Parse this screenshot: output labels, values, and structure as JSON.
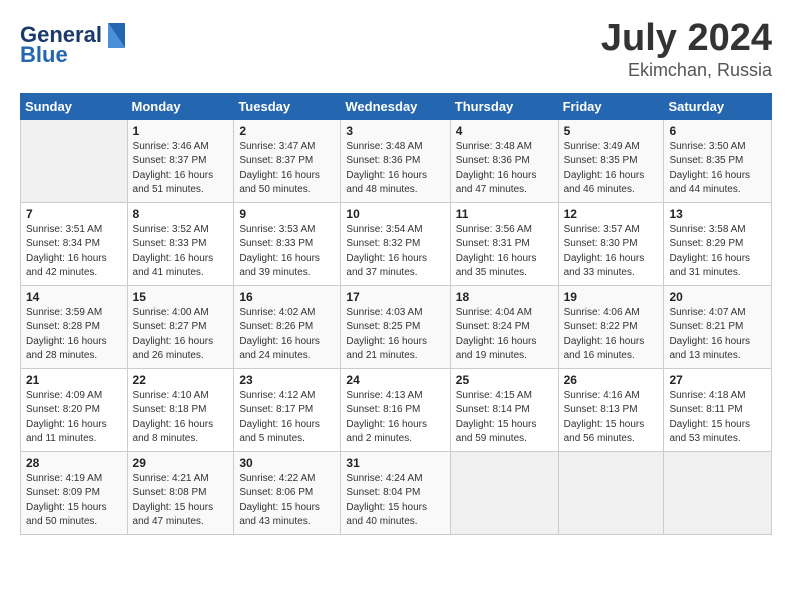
{
  "header": {
    "logo_line1": "General",
    "logo_line2": "Blue",
    "main_title": "July 2024",
    "subtitle": "Ekimchan, Russia"
  },
  "calendar": {
    "days_of_week": [
      "Sunday",
      "Monday",
      "Tuesday",
      "Wednesday",
      "Thursday",
      "Friday",
      "Saturday"
    ],
    "weeks": [
      [
        {
          "day": "",
          "info": ""
        },
        {
          "day": "1",
          "info": "Sunrise: 3:46 AM\nSunset: 8:37 PM\nDaylight: 16 hours\nand 51 minutes."
        },
        {
          "day": "2",
          "info": "Sunrise: 3:47 AM\nSunset: 8:37 PM\nDaylight: 16 hours\nand 50 minutes."
        },
        {
          "day": "3",
          "info": "Sunrise: 3:48 AM\nSunset: 8:36 PM\nDaylight: 16 hours\nand 48 minutes."
        },
        {
          "day": "4",
          "info": "Sunrise: 3:48 AM\nSunset: 8:36 PM\nDaylight: 16 hours\nand 47 minutes."
        },
        {
          "day": "5",
          "info": "Sunrise: 3:49 AM\nSunset: 8:35 PM\nDaylight: 16 hours\nand 46 minutes."
        },
        {
          "day": "6",
          "info": "Sunrise: 3:50 AM\nSunset: 8:35 PM\nDaylight: 16 hours\nand 44 minutes."
        }
      ],
      [
        {
          "day": "7",
          "info": "Sunrise: 3:51 AM\nSunset: 8:34 PM\nDaylight: 16 hours\nand 42 minutes."
        },
        {
          "day": "8",
          "info": "Sunrise: 3:52 AM\nSunset: 8:33 PM\nDaylight: 16 hours\nand 41 minutes."
        },
        {
          "day": "9",
          "info": "Sunrise: 3:53 AM\nSunset: 8:33 PM\nDaylight: 16 hours\nand 39 minutes."
        },
        {
          "day": "10",
          "info": "Sunrise: 3:54 AM\nSunset: 8:32 PM\nDaylight: 16 hours\nand 37 minutes."
        },
        {
          "day": "11",
          "info": "Sunrise: 3:56 AM\nSunset: 8:31 PM\nDaylight: 16 hours\nand 35 minutes."
        },
        {
          "day": "12",
          "info": "Sunrise: 3:57 AM\nSunset: 8:30 PM\nDaylight: 16 hours\nand 33 minutes."
        },
        {
          "day": "13",
          "info": "Sunrise: 3:58 AM\nSunset: 8:29 PM\nDaylight: 16 hours\nand 31 minutes."
        }
      ],
      [
        {
          "day": "14",
          "info": "Sunrise: 3:59 AM\nSunset: 8:28 PM\nDaylight: 16 hours\nand 28 minutes."
        },
        {
          "day": "15",
          "info": "Sunrise: 4:00 AM\nSunset: 8:27 PM\nDaylight: 16 hours\nand 26 minutes."
        },
        {
          "day": "16",
          "info": "Sunrise: 4:02 AM\nSunset: 8:26 PM\nDaylight: 16 hours\nand 24 minutes."
        },
        {
          "day": "17",
          "info": "Sunrise: 4:03 AM\nSunset: 8:25 PM\nDaylight: 16 hours\nand 21 minutes."
        },
        {
          "day": "18",
          "info": "Sunrise: 4:04 AM\nSunset: 8:24 PM\nDaylight: 16 hours\nand 19 minutes."
        },
        {
          "day": "19",
          "info": "Sunrise: 4:06 AM\nSunset: 8:22 PM\nDaylight: 16 hours\nand 16 minutes."
        },
        {
          "day": "20",
          "info": "Sunrise: 4:07 AM\nSunset: 8:21 PM\nDaylight: 16 hours\nand 13 minutes."
        }
      ],
      [
        {
          "day": "21",
          "info": "Sunrise: 4:09 AM\nSunset: 8:20 PM\nDaylight: 16 hours\nand 11 minutes."
        },
        {
          "day": "22",
          "info": "Sunrise: 4:10 AM\nSunset: 8:18 PM\nDaylight: 16 hours\nand 8 minutes."
        },
        {
          "day": "23",
          "info": "Sunrise: 4:12 AM\nSunset: 8:17 PM\nDaylight: 16 hours\nand 5 minutes."
        },
        {
          "day": "24",
          "info": "Sunrise: 4:13 AM\nSunset: 8:16 PM\nDaylight: 16 hours\nand 2 minutes."
        },
        {
          "day": "25",
          "info": "Sunrise: 4:15 AM\nSunset: 8:14 PM\nDaylight: 15 hours\nand 59 minutes."
        },
        {
          "day": "26",
          "info": "Sunrise: 4:16 AM\nSunset: 8:13 PM\nDaylight: 15 hours\nand 56 minutes."
        },
        {
          "day": "27",
          "info": "Sunrise: 4:18 AM\nSunset: 8:11 PM\nDaylight: 15 hours\nand 53 minutes."
        }
      ],
      [
        {
          "day": "28",
          "info": "Sunrise: 4:19 AM\nSunset: 8:09 PM\nDaylight: 15 hours\nand 50 minutes."
        },
        {
          "day": "29",
          "info": "Sunrise: 4:21 AM\nSunset: 8:08 PM\nDaylight: 15 hours\nand 47 minutes."
        },
        {
          "day": "30",
          "info": "Sunrise: 4:22 AM\nSunset: 8:06 PM\nDaylight: 15 hours\nand 43 minutes."
        },
        {
          "day": "31",
          "info": "Sunrise: 4:24 AM\nSunset: 8:04 PM\nDaylight: 15 hours\nand 40 minutes."
        },
        {
          "day": "",
          "info": ""
        },
        {
          "day": "",
          "info": ""
        },
        {
          "day": "",
          "info": ""
        }
      ]
    ]
  }
}
